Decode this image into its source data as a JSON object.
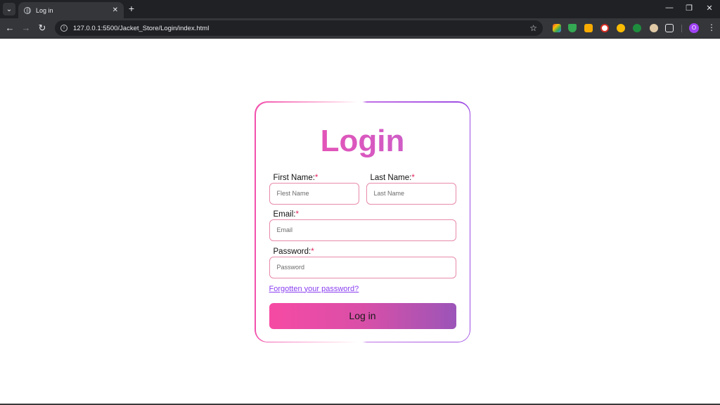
{
  "browser": {
    "tab_title": "Log in",
    "url": "127.0.0.1:5500/Jacket_Store/Login/index.html",
    "profile_initial": "O",
    "icons": {
      "back": "arrow-left-icon",
      "forward": "arrow-right-icon",
      "reload": "reload-icon",
      "site_info": "site-info-icon",
      "bookmark": "star-icon",
      "extensions": "puzzle-icon",
      "menu": "kebab-menu-icon"
    }
  },
  "login": {
    "title": "Login",
    "first_name": {
      "label": "First Name:",
      "required_mark": "*",
      "placeholder": "Flest Name"
    },
    "last_name": {
      "label": "Last Name:",
      "required_mark": "*",
      "placeholder": "Last Name"
    },
    "email": {
      "label": "Email:",
      "required_mark": "*",
      "placeholder": "Email"
    },
    "password": {
      "label": "Password:",
      "required_mark": "*",
      "placeholder": "Password"
    },
    "forgot_link": "Forgotten your password?",
    "submit_label": "Log in"
  },
  "colors": {
    "accent_pink": "#f24fab",
    "accent_purple": "#9d4be3",
    "field_border": "#e88aa9",
    "link": "#8a3ff0"
  }
}
